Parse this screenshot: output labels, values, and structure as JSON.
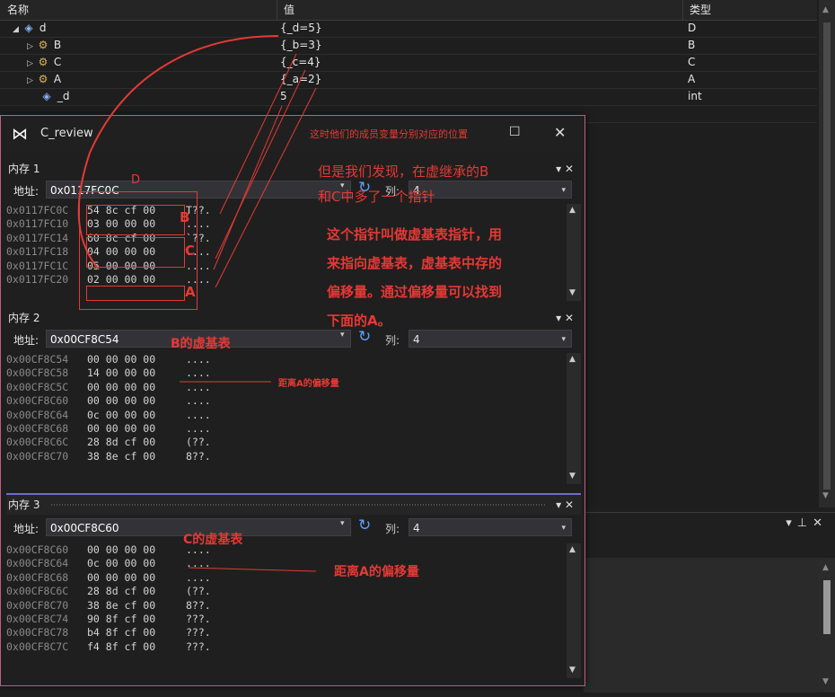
{
  "watch": {
    "headers": {
      "name": "名称",
      "value": "值",
      "type": "类型"
    },
    "rows": [
      {
        "name": "d",
        "value": "{_d=5}",
        "type": "D",
        "expander": "expanded",
        "icon": "variable-icon"
      },
      {
        "name": "B",
        "value": "{_b=3}",
        "type": "B",
        "expander": "collapsed",
        "icon": "base-class-icon"
      },
      {
        "name": "C",
        "value": "{_c=4}",
        "type": "C",
        "expander": "collapsed",
        "icon": "base-class-icon"
      },
      {
        "name": "A",
        "value": "{_a=2}",
        "type": "A",
        "expander": "collapsed",
        "icon": "base-class-icon"
      },
      {
        "name": "_d",
        "value": "5",
        "type": "int",
        "expander": "none",
        "icon": "field-icon"
      }
    ]
  },
  "window": {
    "title": "C_review",
    "logo": "visual-studio-logo-icon",
    "annotation_top": "这时他们的成员变量分别对应的位置"
  },
  "memory1": {
    "title": "内存 1",
    "address_label": "地址:",
    "address": "0x0117FC0C",
    "columns_label": "列:",
    "columns": "4",
    "lines": [
      {
        "addr": "0x0117FC0C",
        "hex": "54 8c cf 00",
        "ascii": "T??."
      },
      {
        "addr": "0x0117FC10",
        "hex": "03 00 00 00",
        "ascii": "...."
      },
      {
        "addr": "0x0117FC14",
        "hex": "60 8c cf 00",
        "ascii": "`??."
      },
      {
        "addr": "0x0117FC18",
        "hex": "04 00 00 00",
        "ascii": "...."
      },
      {
        "addr": "0x0117FC1C",
        "hex": "05 00 00 00",
        "ascii": "...."
      },
      {
        "addr": "0x0117FC20",
        "hex": "02 00 00 00",
        "ascii": "...."
      }
    ]
  },
  "memory2": {
    "title": "内存 2",
    "address_label": "地址:",
    "address": "0x00CF8C54",
    "columns_label": "列:",
    "columns": "4",
    "lines": [
      {
        "addr": "0x00CF8C54",
        "hex": "00 00 00 00",
        "ascii": "...."
      },
      {
        "addr": "0x00CF8C58",
        "hex": "14 00 00 00",
        "ascii": "...."
      },
      {
        "addr": "0x00CF8C5C",
        "hex": "00 00 00 00",
        "ascii": "...."
      },
      {
        "addr": "0x00CF8C60",
        "hex": "00 00 00 00",
        "ascii": "...."
      },
      {
        "addr": "0x00CF8C64",
        "hex": "0c 00 00 00",
        "ascii": "...."
      },
      {
        "addr": "0x00CF8C68",
        "hex": "00 00 00 00",
        "ascii": "...."
      },
      {
        "addr": "0x00CF8C6C",
        "hex": "28 8d cf 00",
        "ascii": "(??."
      },
      {
        "addr": "0x00CF8C70",
        "hex": "38 8e cf 00",
        "ascii": "8??."
      }
    ]
  },
  "memory3": {
    "title": "内存 3",
    "address_label": "地址:",
    "address": "0x00CF8C60",
    "columns_label": "列:",
    "columns": "4",
    "lines": [
      {
        "addr": "0x00CF8C60",
        "hex": "00 00 00 00",
        "ascii": "...."
      },
      {
        "addr": "0x00CF8C64",
        "hex": "0c 00 00 00",
        "ascii": "...."
      },
      {
        "addr": "0x00CF8C68",
        "hex": "00 00 00 00",
        "ascii": "...."
      },
      {
        "addr": "0x00CF8C6C",
        "hex": "28 8d cf 00",
        "ascii": "(??."
      },
      {
        "addr": "0x00CF8C70",
        "hex": "38 8e cf 00",
        "ascii": "8??."
      },
      {
        "addr": "0x00CF8C74",
        "hex": "90 8f cf 00",
        "ascii": "???."
      },
      {
        "addr": "0x00CF8C78",
        "hex": "b4 8f cf 00",
        "ascii": "???."
      },
      {
        "addr": "0x00CF8C7C",
        "hex": "f4 8f cf 00",
        "ascii": "???."
      }
    ]
  },
  "annotations": {
    "d_label": "D",
    "b_label": "B",
    "c_label": "C",
    "a_label": "A",
    "vbptr_line1": "但是我们发现，在虚继承的B",
    "vbptr_line2": "和C中多了一个指针",
    "explain_1": "这个指针叫做虚基表指针，用",
    "explain_2": "来指向虚基表，虚基表中存的",
    "explain_3": "偏移量。通过偏移量可以找到",
    "explain_4": "下面的A。",
    "b_vtable": "B的虚基表",
    "offset_a_small": "距离A的偏移量",
    "c_vtable": "C的虚基表",
    "offset_a_large": "距离A的偏移量"
  },
  "colors": {
    "annotation": "#e53935",
    "window_border": "#c15c84",
    "active_pane": "#6f6ad1",
    "link_blue": "#5ba0ff"
  }
}
